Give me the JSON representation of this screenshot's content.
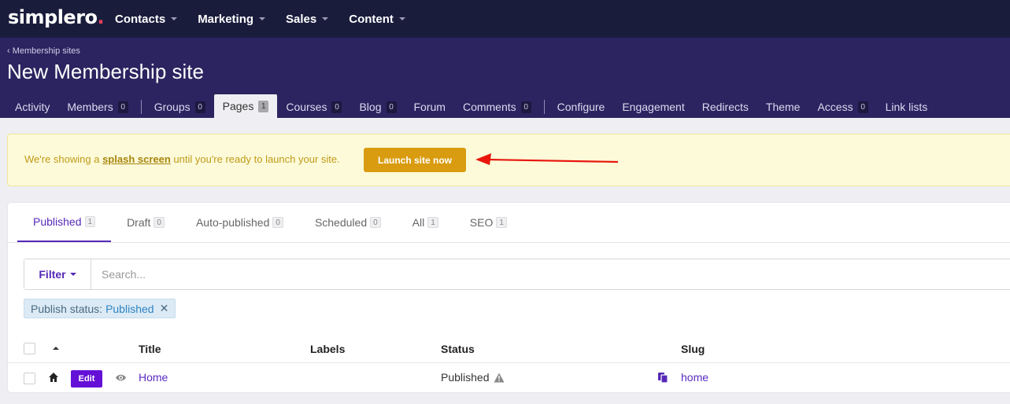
{
  "topbar": {
    "logo": "simplero",
    "logo_dot": ".",
    "nav": [
      {
        "label": "Contacts"
      },
      {
        "label": "Marketing"
      },
      {
        "label": "Sales"
      },
      {
        "label": "Content"
      }
    ]
  },
  "header": {
    "breadcrumb": "‹ Membership sites",
    "title": "New Membership site",
    "tabs": [
      {
        "label": "Activity",
        "badge": ""
      },
      {
        "label": "Members",
        "badge": "0"
      },
      {
        "label": "Groups",
        "badge": "0"
      },
      {
        "label": "Pages",
        "badge": "1",
        "active": true
      },
      {
        "label": "Courses",
        "badge": "0"
      },
      {
        "label": "Blog",
        "badge": "0"
      },
      {
        "label": "Forum",
        "badge": ""
      },
      {
        "label": "Comments",
        "badge": "0"
      },
      {
        "label": "Configure",
        "badge": ""
      },
      {
        "label": "Engagement",
        "badge": ""
      },
      {
        "label": "Redirects",
        "badge": ""
      },
      {
        "label": "Theme",
        "badge": ""
      },
      {
        "label": "Access",
        "badge": "0"
      },
      {
        "label": "Link lists",
        "badge": ""
      }
    ]
  },
  "alert": {
    "text_before": "We're showing a ",
    "link": "splash screen",
    "text_after": " until you're ready to launch your site.",
    "button": "Launch site now",
    "arrow_color": "#e8160c"
  },
  "subtabs": [
    {
      "label": "Published",
      "count": "1",
      "active": true
    },
    {
      "label": "Draft",
      "count": "0"
    },
    {
      "label": "Auto-published",
      "count": "0"
    },
    {
      "label": "Scheduled",
      "count": "0"
    },
    {
      "label": "All",
      "count": "1"
    },
    {
      "label": "SEO",
      "count": "1"
    }
  ],
  "filter": {
    "button": "Filter",
    "search_placeholder": "Search...",
    "chip_label": "Publish status:",
    "chip_value": "Published",
    "chip_close": "✕"
  },
  "table": {
    "columns": {
      "title": "Title",
      "labels": "Labels",
      "status": "Status",
      "slug": "Slug"
    },
    "rows": [
      {
        "title": "Home",
        "labels": "",
        "status": "Published",
        "slug": "home",
        "edit": "Edit"
      }
    ]
  },
  "colors": {
    "primary": "#5528b8",
    "nav_bg": "#1a1c3c",
    "header_bg": "#2b2460",
    "launch": "#d99c10",
    "edit": "#6410d6"
  }
}
